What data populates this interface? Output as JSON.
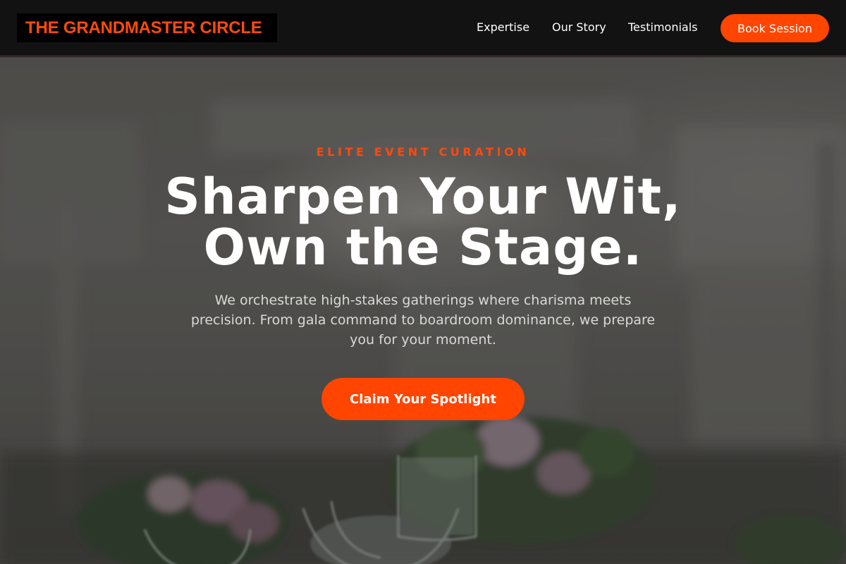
{
  "brand": {
    "name": "THE GRANDMASTER CIRCLE",
    "accent_color": "#ff4500"
  },
  "nav": {
    "links": [
      {
        "label": "Expertise"
      },
      {
        "label": "Our Story"
      },
      {
        "label": "Testimonials"
      }
    ],
    "book_label": "Book Session"
  },
  "hero": {
    "eyebrow": "ELITE EVENT CURATION",
    "headline_line1": "Sharpen Your Wit,",
    "headline_line2": "Own the Stage.",
    "subtext": "We orchestrate high-stakes gatherings where charisma meets precision. From gala command to boardroom dominance, we prepare you for your moment.",
    "cta_label": "Claim Your Spotlight"
  }
}
